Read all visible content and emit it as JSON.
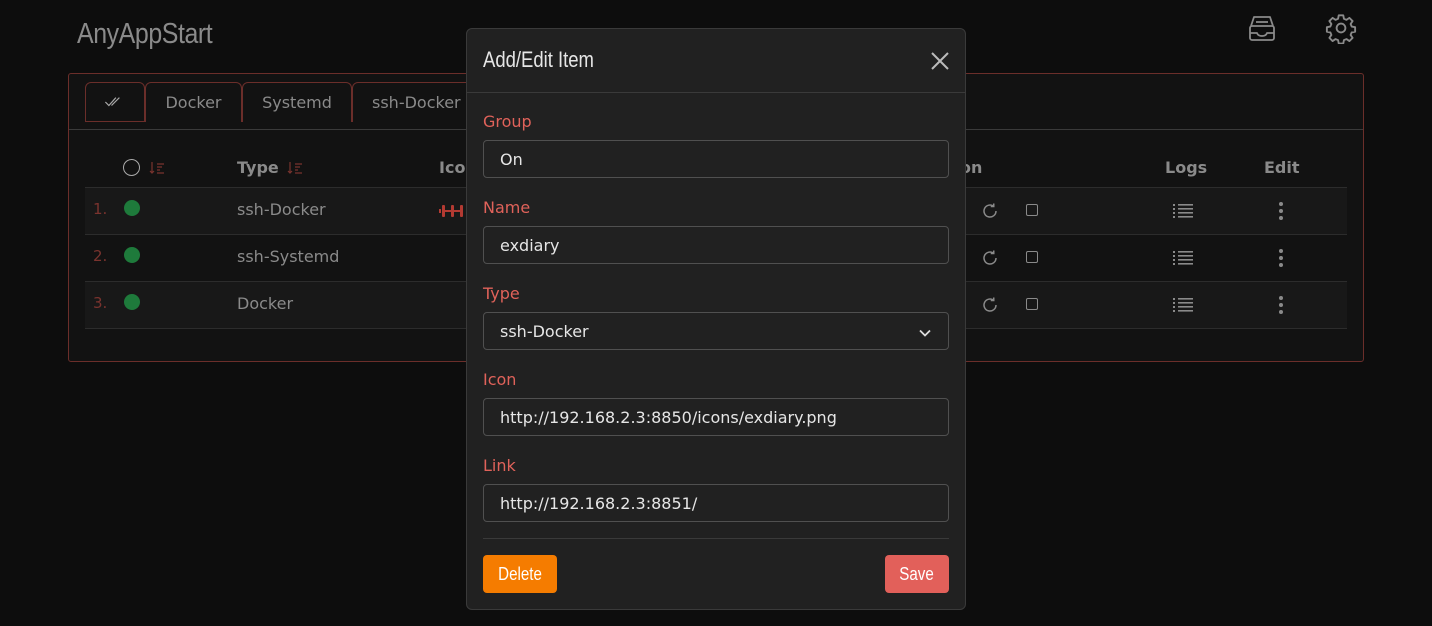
{
  "app": {
    "title": "AnyAppStart",
    "top_icons": [
      "inbox-stack-icon",
      "gear-icon"
    ]
  },
  "tabs": [
    {
      "label": "",
      "icon": "double-check-icon",
      "active": true
    },
    {
      "label": "Docker"
    },
    {
      "label": "Systemd"
    },
    {
      "label": "ssh-Docker"
    }
  ],
  "table": {
    "headers": {
      "type": "Type",
      "icon": "Icon",
      "action": "Action",
      "logs": "Logs",
      "edit": "Edit"
    },
    "rows": [
      {
        "num": "1.",
        "status_color": "#1e7a3b",
        "type": "ssh-Docker",
        "has_icon": true
      },
      {
        "num": "2.",
        "status_color": "#1e7a3b",
        "type": "ssh-Systemd",
        "has_icon": false
      },
      {
        "num": "3.",
        "status_color": "#1e7a3b",
        "type": "Docker",
        "has_icon": false
      }
    ]
  },
  "modal": {
    "title": "Add/Edit Item",
    "fields": {
      "group": {
        "label": "Group",
        "value": "On"
      },
      "name": {
        "label": "Name",
        "value": "exdiary"
      },
      "type": {
        "label": "Type",
        "value": "ssh-Docker"
      },
      "icon": {
        "label": "Icon",
        "value": "http://192.168.2.3:8850/icons/exdiary.png"
      },
      "link": {
        "label": "Link",
        "value": "http://192.168.2.3:8851/"
      }
    },
    "delete_label": "Delete",
    "save_label": "Save"
  },
  "colors": {
    "accent": "#e0625a",
    "delete": "#f57c00",
    "save": "#e2605a",
    "status_on": "#1e7a3b"
  }
}
